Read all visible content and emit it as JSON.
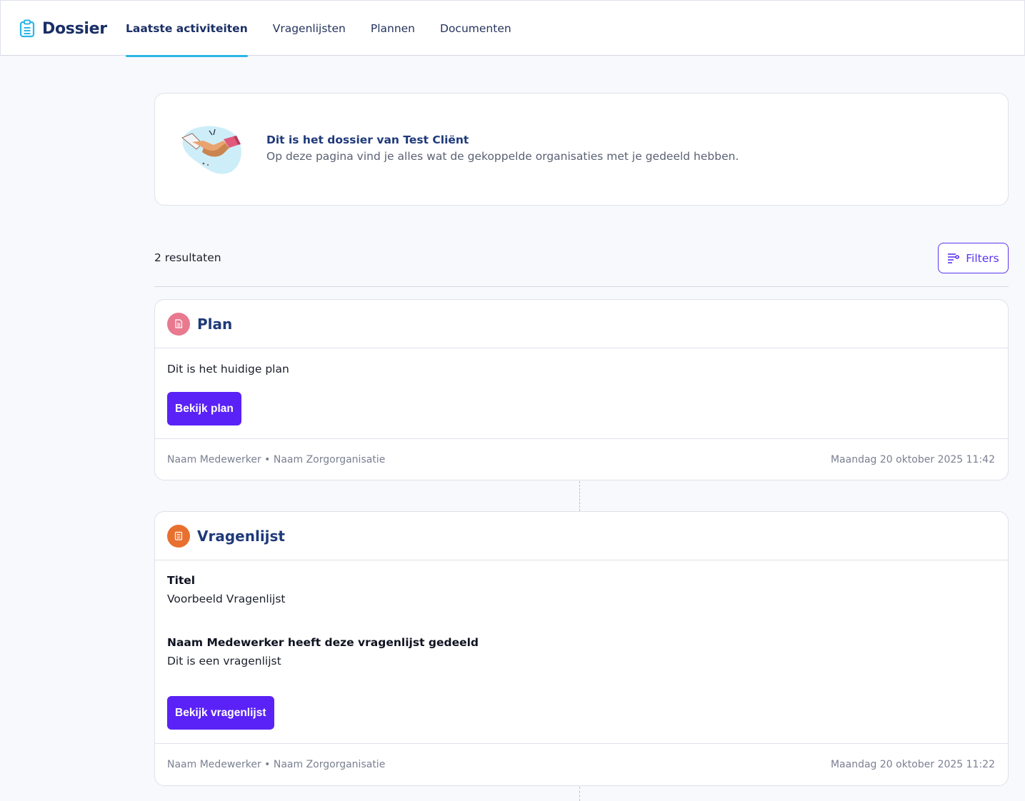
{
  "header": {
    "brand": "Dossier",
    "tabs": [
      {
        "label": "Laatste activiteiten",
        "active": true
      },
      {
        "label": "Vragenlijsten",
        "active": false
      },
      {
        "label": "Plannen",
        "active": false
      },
      {
        "label": "Documenten",
        "active": false
      }
    ]
  },
  "intro": {
    "title": "Dit is het dossier van Test Cliënt",
    "subtitle": "Op deze pagina vind je alles wat de gekoppelde organisaties met je gedeeld hebben.",
    "illustration": "handshake-illustration"
  },
  "results": {
    "count_label": "2 resultaten",
    "filters_label": "Filters"
  },
  "activities": [
    {
      "type": "Plan",
      "icon": "document-icon",
      "badge_color": "#e8798f",
      "description": "Dit is het huidige plan",
      "button_label": "Bekijk plan",
      "author": "Naam Medewerker • Naam Zorgorganisatie",
      "timestamp": "Maandag 20 oktober 2025 11:42"
    },
    {
      "type": "Vragenlijst",
      "icon": "list-icon",
      "badge_color": "#e8702f",
      "title_label": "Titel",
      "title_value": "Voorbeeld Vragenlijst",
      "shared_label": "Naam Medewerker heeft deze vragenlijst gedeeld",
      "shared_value": "Dit is een vragenlijst",
      "button_label": "Bekijk vragenlijst",
      "author": "Naam Medewerker • Naam Zorgorganisatie",
      "timestamp": "Maandag 20 oktober 2025 11:22"
    }
  ],
  "colors": {
    "primary": "#5a22f6",
    "accent_tab": "#29b6e6",
    "heading": "#1f3a7a"
  }
}
